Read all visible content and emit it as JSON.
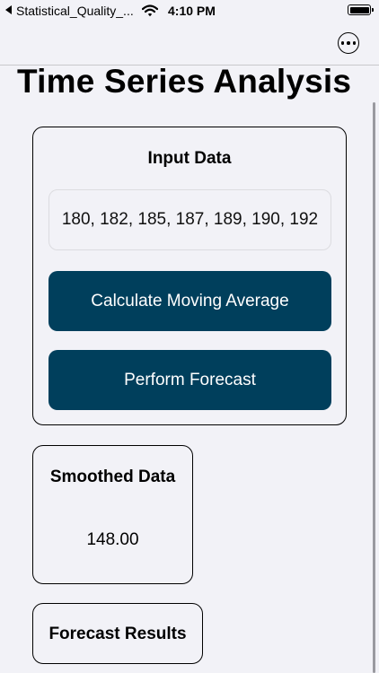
{
  "status_bar": {
    "back_app": "Statistical_Quality_...",
    "time": "4:10 PM"
  },
  "icons": {
    "back": "back-arrow-icon",
    "wifi": "wifi-icon",
    "battery": "battery-icon",
    "more": "more-ellipsis-icon"
  },
  "page": {
    "title": "Time Series Analysis"
  },
  "input_section": {
    "title": "Input Data",
    "data_value": "180, 182, 185, 187, 189, 190, 192",
    "moving_average_label": "Calculate Moving Average",
    "forecast_label": "Perform Forecast"
  },
  "smoothed_section": {
    "title": "Smoothed Data",
    "value": "148.00"
  },
  "forecast_section": {
    "title": "Forecast Results"
  },
  "colors": {
    "background": "#f2f2f7",
    "button": "#003f5c",
    "button_text": "#ffffff"
  }
}
